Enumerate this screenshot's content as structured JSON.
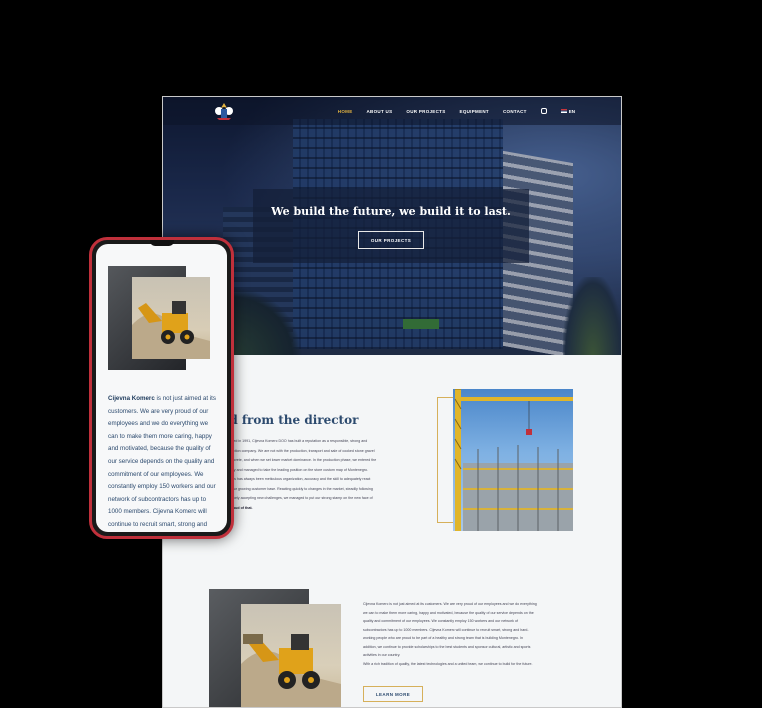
{
  "desktop": {
    "nav": {
      "items": [
        {
          "label": "HOME",
          "active": true
        },
        {
          "label": "ABOUT US",
          "active": false
        },
        {
          "label": "OUR PROJECTS",
          "active": false
        },
        {
          "label": "EQUIPMENT",
          "active": false
        },
        {
          "label": "CONTACT",
          "active": false
        }
      ],
      "language": "EN",
      "icons": [
        "logo-icon",
        "instagram-icon",
        "flag-icon"
      ]
    },
    "hero": {
      "title": "We build the future, we build it to last.",
      "button_label": "OUR PROJECTS"
    },
    "director": {
      "title": "rd from the director",
      "lines": [
        "tablished in 1991, Cijevna Komerc DOO has built a reputation as a responsible, strong and",
        "onstruction company. We are not with the production, transport and sale of cooked stone gravel",
        "nd concrete, and when we set lower market dominance. In the production phase, we entered the",
        "industry and managed to take the leading position on the store custom map of Montenegro.",
        "",
        "success has always been meticulous organization, accuracy and the skill to adequately react",
        "ds of our growing customer base. Reacting quickly to changes in the market, steadily following",
        "nd bravely accepting new challenges, we managed to put our strong stamp on the new face of",
        "are proud of that."
      ]
    },
    "about": {
      "lines": [
        "Cijevna Komerc is not just aimed at its customers. We are very proud of our employees and we do everything",
        "we can to make them more caring, happy and motivated, because the quality of our service depends on the",
        "quality and commitment of our employees. We constantly employ 150 workers and our network of",
        "subcontractors has up to 1000 members. Cijevna Komerc will continue to recruit smart, strong and hard-",
        "working people who are proud to be part of a healthy and strong team that is building Montenegro. In",
        "addition, we continue to provide scholarships to the best students and sponsor cultural, artistic and sports",
        "activities in our country.",
        "",
        "With a rich tradition of quality, the latest technologies and a united team, we continue to build for the future."
      ],
      "button_label": "LEARN MORE"
    }
  },
  "phone": {
    "lines": [
      {
        "bold": "Cijevna Komerc",
        "rest": " is not just aimed at its"
      },
      {
        "bold": "",
        "rest": "customers. We are very proud of our"
      },
      {
        "bold": "",
        "rest": "employees and we do everything we"
      },
      {
        "bold": "",
        "rest": "can to make them more caring, happy"
      },
      {
        "bold": "",
        "rest": "and motivated, because the quality of"
      },
      {
        "bold": "",
        "rest": "our service depends on the quality and"
      },
      {
        "bold": "",
        "rest": "commitment of our employees. We"
      },
      {
        "bold": "",
        "rest": "constantly employ 150 workers and our"
      },
      {
        "bold": "",
        "rest": "network of subcontractors has up to"
      },
      {
        "bold": "",
        "rest": "1000 members. Cijevna Komerc will"
      },
      {
        "bold": "",
        "rest": "continue to recruit smart, strong and"
      }
    ]
  },
  "colors": {
    "accent_gold": "#e3b341",
    "heading_blue": "#2c4a6e",
    "phone_frame": "#c0303b",
    "background": "#000000"
  }
}
